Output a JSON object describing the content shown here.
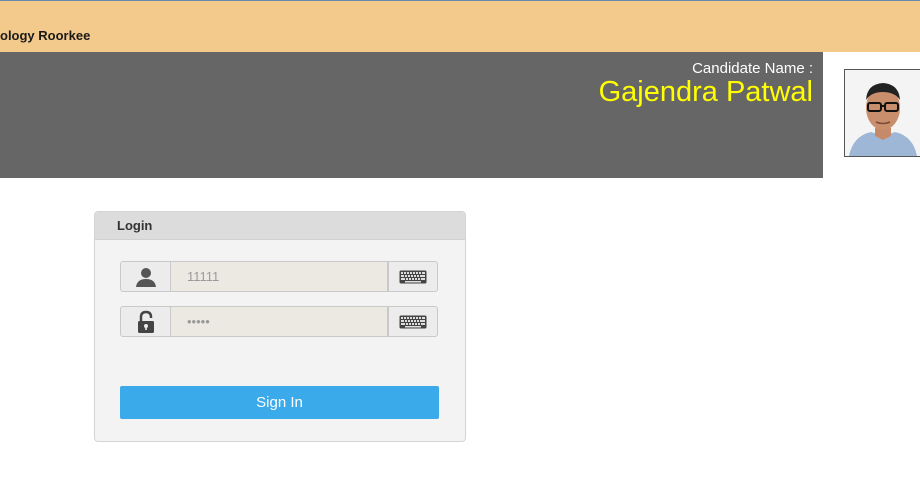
{
  "institute": {
    "name_fragment": "ology Roorkee"
  },
  "candidate": {
    "label": "Candidate Name :",
    "name": "Gajendra Patwal"
  },
  "login": {
    "title": "Login",
    "username": {
      "value": "11111",
      "icon": "user-icon",
      "keyboard_icon": "keyboard-icon"
    },
    "password": {
      "value": "•••••",
      "icon": "lock-icon",
      "keyboard_icon": "keyboard-icon"
    },
    "signin_label": "Sign In"
  },
  "colors": {
    "topbar": "#f4ca8c",
    "header": "#666666",
    "candidate_name": "#ffff00",
    "signin": "#3aaaeb"
  }
}
